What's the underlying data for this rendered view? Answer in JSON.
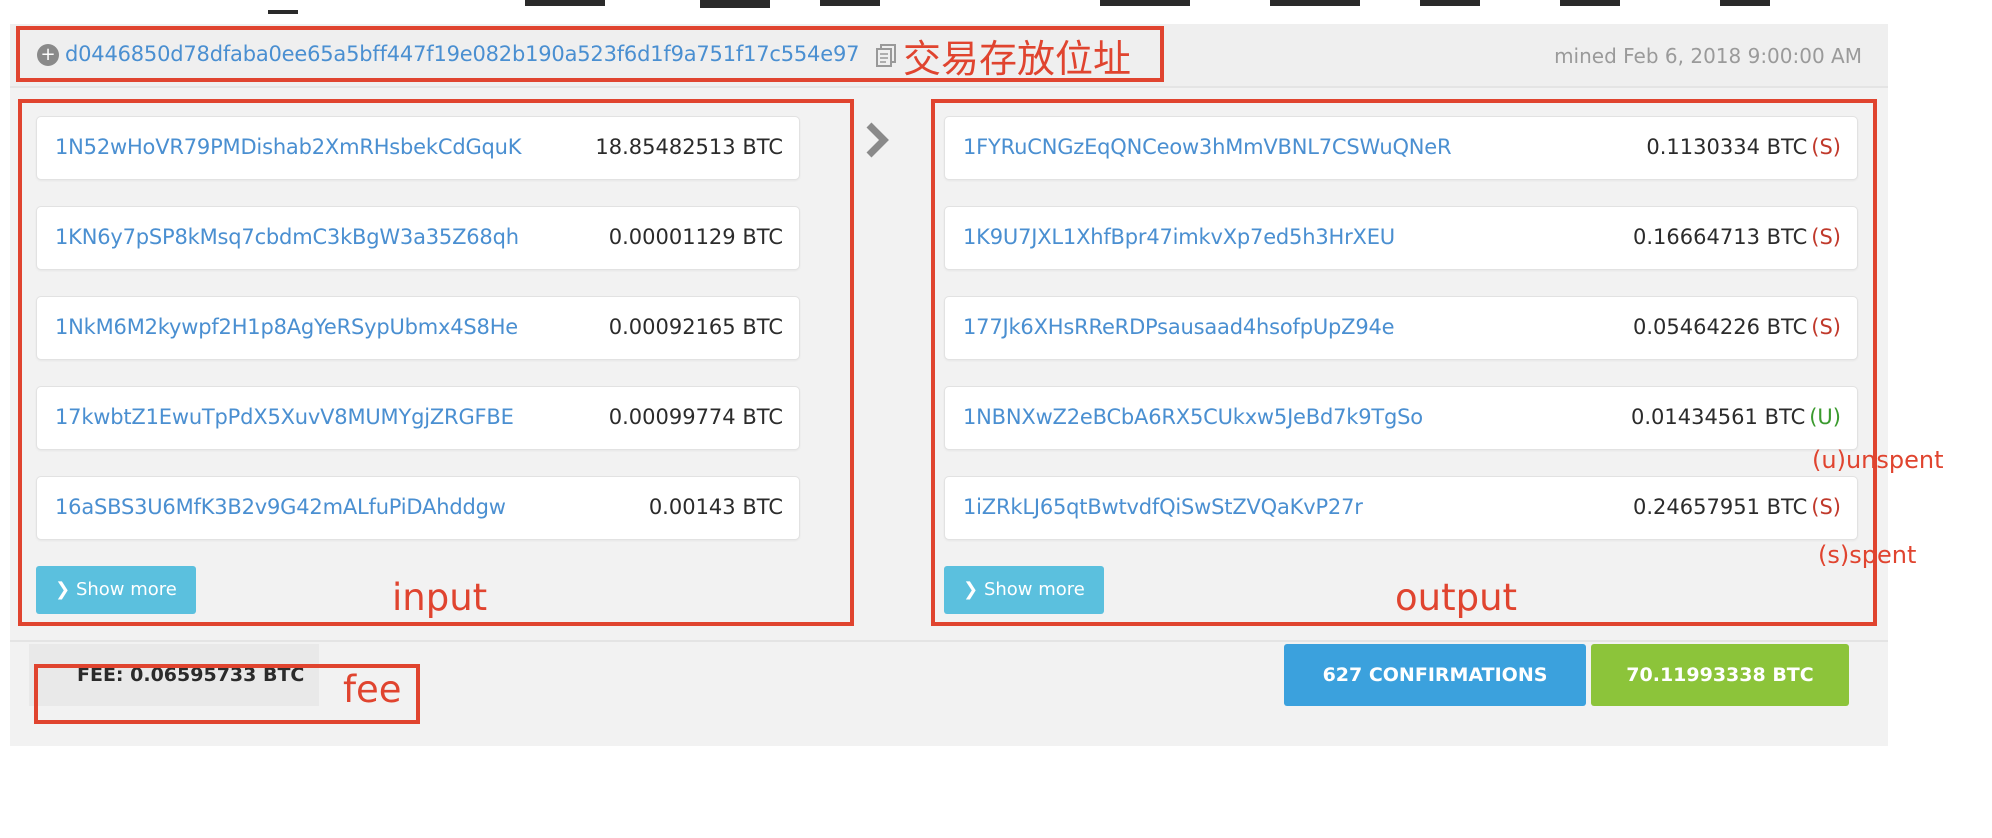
{
  "transaction": {
    "txid": "d0446850d78dfaba0ee65a5bff447f19e082b190a523f6d1f9a751f17c554e97",
    "mined": "mined Feb 6, 2018 9:00:00 AM"
  },
  "inputs": [
    {
      "address": "1N52wHoVR79PMDishab2XmRHsbekCdGquK",
      "amount": "18.85482513 BTC"
    },
    {
      "address": "1KN6y7pSP8kMsq7cbdmC3kBgW3a35Z68qh",
      "amount": "0.00001129 BTC"
    },
    {
      "address": "1NkM6M2kywpf2H1p8AgYeRSypUbmx4S8He",
      "amount": "0.00092165 BTC"
    },
    {
      "address": "17kwbtZ1EwuTpPdX5XuvV8MUMYgjZRGFBE",
      "amount": "0.00099774 BTC"
    },
    {
      "address": "16aSBS3U6MfK3B2v9G42mALfuPiDAhddgw",
      "amount": "0.00143 BTC"
    }
  ],
  "outputs": [
    {
      "address": "1FYRuCNGzEqQNCeow3hMmVBNL7CSWuQNeR",
      "amount": "0.1130334 BTC",
      "status": "(S)"
    },
    {
      "address": "1K9U7JXL1XhfBpr47imkvXp7ed5h3HrXEU",
      "amount": "0.16664713 BTC",
      "status": "(S)"
    },
    {
      "address": "177Jk6XHsRReRDPsausaad4hsofpUpZ94e",
      "amount": "0.05464226 BTC",
      "status": "(S)"
    },
    {
      "address": "1NBNXwZ2eBCbA6RX5CUkxw5JeBd7k9TgSo",
      "amount": "0.01434561 BTC",
      "status": "(U)"
    },
    {
      "address": "1iZRkLJ65qtBwtvdfQiSwStZVQaKvP27r",
      "amount": "0.24657951 BTC",
      "status": "(S)"
    }
  ],
  "show_more_label": "Show more",
  "fee": "FEE: 0.06595733 BTC",
  "confirmations": "627 CONFIRMATIONS",
  "total": "70.11993338 BTC",
  "annotations": {
    "txid_note": "交易存放位址",
    "input": "input",
    "output": "output",
    "fee": "fee",
    "unspent": "(u)unspent",
    "spent": "(s)spent"
  },
  "colors": {
    "link": "#4a8fd1",
    "annotation": "#e0442f",
    "spent": "#c0392b",
    "unspent": "#3a9a2e",
    "confirmations_bg": "#3ba1dd",
    "total_bg": "#8cc43a",
    "show_more_bg": "#5bc0de"
  },
  "icons": {
    "txid": "circle-plus-icon",
    "copy": "copy-icon",
    "direction": "chevron-right-icon",
    "show_more": "chevron-down-icon"
  }
}
